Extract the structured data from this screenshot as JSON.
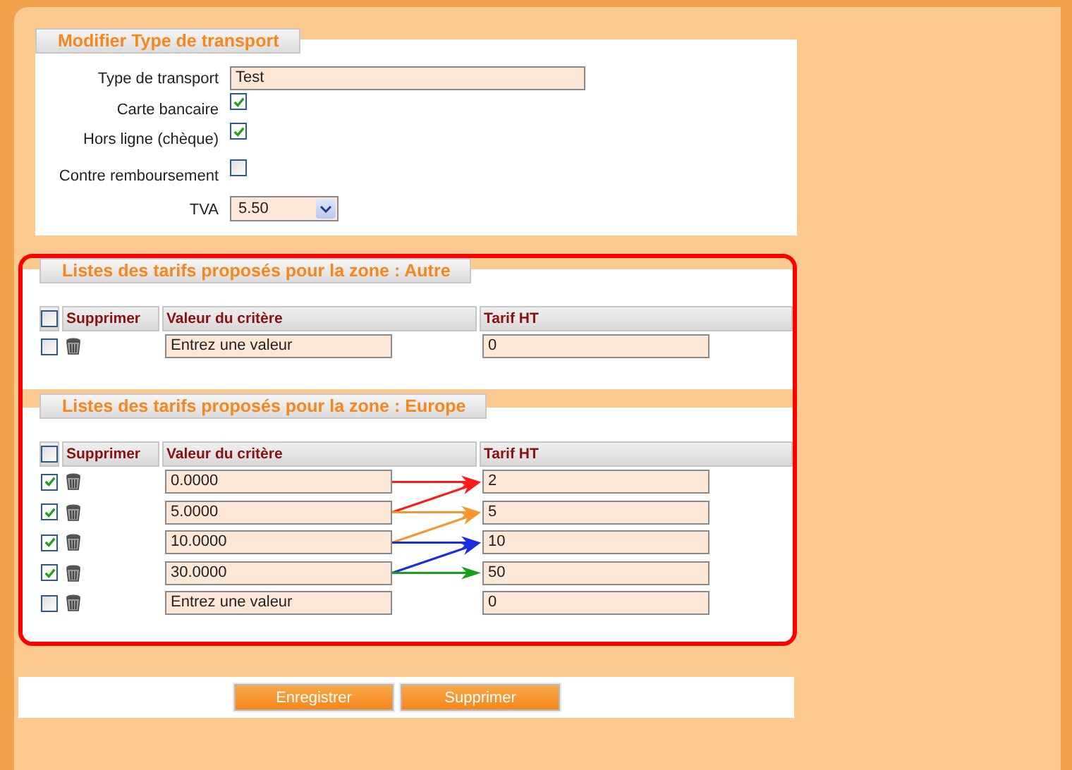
{
  "form": {
    "title": "Modifier Type de transport",
    "fields": [
      {
        "kind": "text",
        "label": "Type de transport",
        "value": "Test"
      },
      {
        "kind": "checkbox",
        "label": "Carte bancaire",
        "checked": true
      },
      {
        "kind": "checkbox",
        "label": "Hors ligne (chèque)",
        "checked": true
      },
      {
        "kind": "checkbox",
        "label": "Contre remboursement",
        "checked": false
      },
      {
        "kind": "select",
        "label": "TVA",
        "value": "5.50"
      }
    ]
  },
  "zones": [
    {
      "title": "Listes des tarifs proposés pour la zone : Autre",
      "columns": [
        "Supprimer",
        "Valeur du critère",
        "Tarif HT"
      ],
      "select_all": {
        "checked": false
      },
      "rows": [
        {
          "checked": false,
          "value": "Entrez une valeur",
          "tarif": "0"
        }
      ]
    },
    {
      "title": "Listes des tarifs proposés pour la zone : Europe",
      "columns": [
        "Supprimer",
        "Valeur du critère",
        "Tarif HT"
      ],
      "select_all": {
        "checked": false
      },
      "rows": [
        {
          "checked": true,
          "value": "0.0000",
          "tarif": "2",
          "arrows": [
            {
              "kind": "straight",
              "color": "#ff1a1a"
            }
          ]
        },
        {
          "checked": true,
          "value": "5.0000",
          "tarif": "5",
          "arrows": [
            {
              "kind": "rising",
              "color": "#ff1a1a"
            },
            {
              "kind": "straight",
              "color": "#f7962e"
            }
          ]
        },
        {
          "checked": true,
          "value": "10.0000",
          "tarif": "10",
          "arrows": [
            {
              "kind": "rising",
              "color": "#f7962e"
            },
            {
              "kind": "straight",
              "color": "#1a2ee0"
            }
          ]
        },
        {
          "checked": true,
          "value": "30.0000",
          "tarif": "50",
          "arrows": [
            {
              "kind": "rising",
              "color": "#1a2ee0"
            },
            {
              "kind": "straight",
              "color": "#16a016"
            }
          ]
        },
        {
          "checked": false,
          "value": "Entrez une valeur",
          "tarif": "0"
        }
      ]
    }
  ],
  "buttons": [
    "Enregistrer",
    "Supprimer"
  ]
}
